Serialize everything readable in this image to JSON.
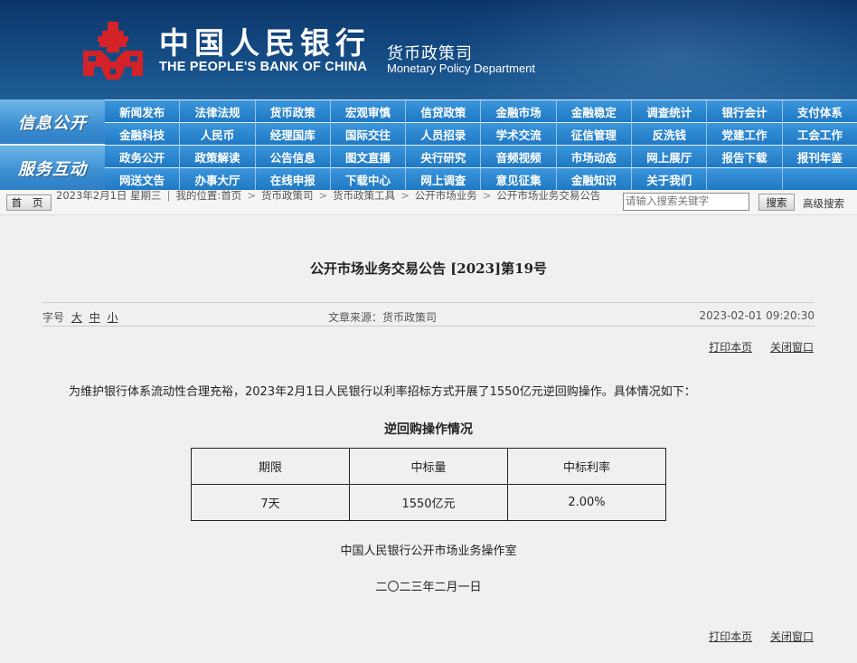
{
  "header": {
    "brand_cn": "中国人民银行",
    "brand_en": "THE PEOPLE'S BANK OF CHINA",
    "dept_cn": "货币政策司",
    "dept_en": "Monetary Policy Department",
    "colors": {
      "banner": "#12477f",
      "logo": "#d42328"
    }
  },
  "nav": {
    "group1_label": "信息公开",
    "group2_label": "服务互动",
    "row1": [
      "新闻发布",
      "法律法规",
      "货币政策",
      "宏观审慎",
      "信贷政策",
      "金融市场",
      "金融稳定",
      "调查统计",
      "银行会计",
      "支付体系"
    ],
    "row2": [
      "金融科技",
      "人民币",
      "经理国库",
      "国际交往",
      "人员招录",
      "学术交流",
      "征信管理",
      "反洗钱",
      "党建工作",
      "工会工作"
    ],
    "row3": [
      "政务公开",
      "政策解读",
      "公告信息",
      "图文直播",
      "央行研究",
      "音频视频",
      "市场动态",
      "网上展厅",
      "报告下载",
      "报刊年鉴"
    ],
    "row4": [
      "网送文告",
      "办事大厅",
      "在线申报",
      "下载中心",
      "网上调查",
      "意见征集",
      "金融知识",
      "关于我们"
    ]
  },
  "crumb": {
    "home_label": "首 页",
    "date": "2023年2月1日 星期三",
    "location_label": "我的位置:",
    "items": [
      "首页",
      "货币政策司",
      "货币政策工具",
      "公开市场业务",
      "公开市场业务交易公告"
    ],
    "search_placeholder": "请输入搜索关键字",
    "search_button": "搜索",
    "advanced_search": "高级搜索"
  },
  "article": {
    "title": "公开市场业务交易公告 [2023]第19号",
    "font_label": "字号",
    "font_large": "大",
    "font_medium": "中",
    "font_small": "小",
    "source": "文章来源：货币政策司",
    "datetime": "2023-02-01 09:20:30",
    "print_link": "打印本页",
    "close_link": "关闭窗口",
    "paragraph": "为维护银行体系流动性合理充裕，2023年2月1日人民银行以利率招标方式开展了1550亿元逆回购操作。具体情况如下：",
    "table_title": "逆回购操作情况",
    "table": {
      "headers": [
        "期限",
        "中标量",
        "中标利率"
      ],
      "rows": [
        [
          "7天",
          "1550亿元",
          "2.00%"
        ]
      ]
    },
    "signature_org": "中国人民银行公开市场业务操作室",
    "signature_date": "二〇二三年二月一日"
  }
}
